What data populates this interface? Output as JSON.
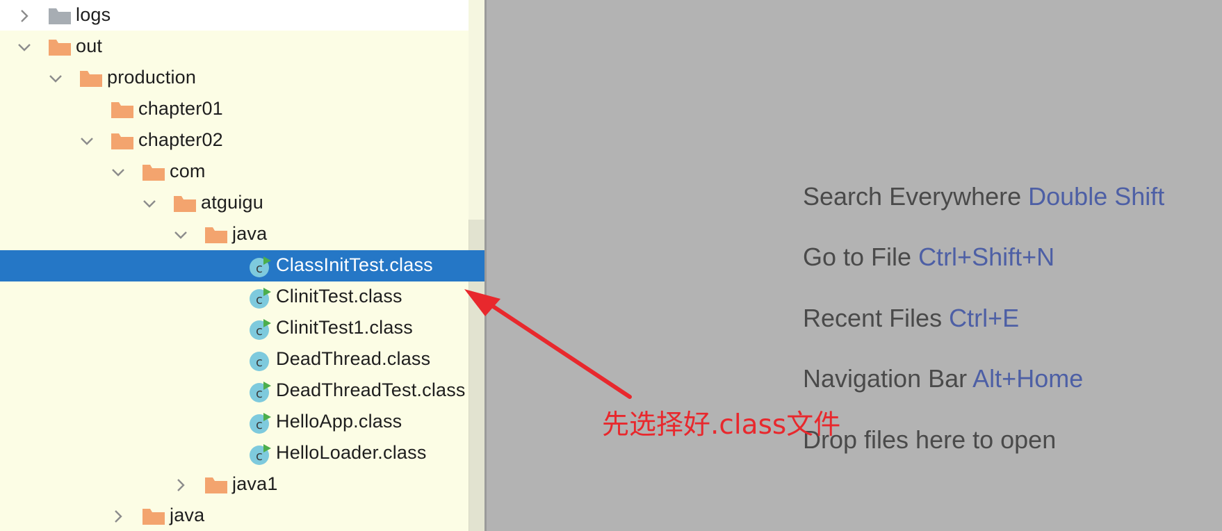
{
  "project_tree": {
    "items": [
      {
        "label": "logs",
        "type": "folder",
        "color": "#a7adb3",
        "expanded": false,
        "has_toggle": true
      },
      {
        "label": "out",
        "type": "folder",
        "color": "#f3a46e",
        "expanded": true,
        "has_toggle": true
      },
      {
        "label": "production",
        "type": "folder",
        "color": "#f3a46e",
        "expanded": true,
        "has_toggle": true
      },
      {
        "label": "chapter01",
        "type": "folder",
        "color": "#f3a46e",
        "expanded": false,
        "has_toggle": false
      },
      {
        "label": "chapter02",
        "type": "folder",
        "color": "#f3a46e",
        "expanded": true,
        "has_toggle": true
      },
      {
        "label": "com",
        "type": "folder",
        "color": "#f3a46e",
        "expanded": true,
        "has_toggle": true
      },
      {
        "label": "atguigu",
        "type": "folder",
        "color": "#f3a46e",
        "expanded": true,
        "has_toggle": true
      },
      {
        "label": "java",
        "type": "folder",
        "color": "#f3a46e",
        "expanded": true,
        "has_toggle": true
      },
      {
        "label": "ClassInitTest.class",
        "type": "class",
        "runnable": true,
        "selected": true
      },
      {
        "label": "ClinitTest.class",
        "type": "class",
        "runnable": true
      },
      {
        "label": "ClinitTest1.class",
        "type": "class",
        "runnable": true
      },
      {
        "label": "DeadThread.class",
        "type": "class",
        "runnable": false
      },
      {
        "label": "DeadThreadTest.class",
        "type": "class",
        "runnable": true
      },
      {
        "label": "HelloApp.class",
        "type": "class",
        "runnable": true
      },
      {
        "label": "HelloLoader.class",
        "type": "class",
        "runnable": true
      },
      {
        "label": "java1",
        "type": "folder",
        "color": "#f3a46e",
        "expanded": false,
        "has_toggle": true
      },
      {
        "label": "java",
        "type": "folder",
        "color": "#f3a46e",
        "expanded": false,
        "has_toggle": true
      }
    ]
  },
  "editor_hints": {
    "items": [
      {
        "text": "Search Everywhere ",
        "key": "Double Shift"
      },
      {
        "text": "Go to File ",
        "key": "Ctrl+Shift+N"
      },
      {
        "text": "Recent Files ",
        "key": "Ctrl+E"
      },
      {
        "text": "Navigation Bar ",
        "key": "Alt+Home"
      },
      {
        "text": "Drop files here to open",
        "key": ""
      }
    ]
  },
  "annotation": {
    "text": "先选择好.class文件",
    "color": "#e8282d"
  },
  "colors": {
    "tree_background": "#fcfde5",
    "selection": "#2577c6",
    "editor_background": "#b3b3b3",
    "shortcut_key": "#4d5fa5",
    "class_icon": "#7ecadd",
    "run_marker": "#4cae4c"
  },
  "icons": {
    "chevron_collapsed": "chevron-right-icon",
    "chevron_expanded": "chevron-down-icon",
    "folder": "folder-icon",
    "class": "java-class-icon"
  }
}
